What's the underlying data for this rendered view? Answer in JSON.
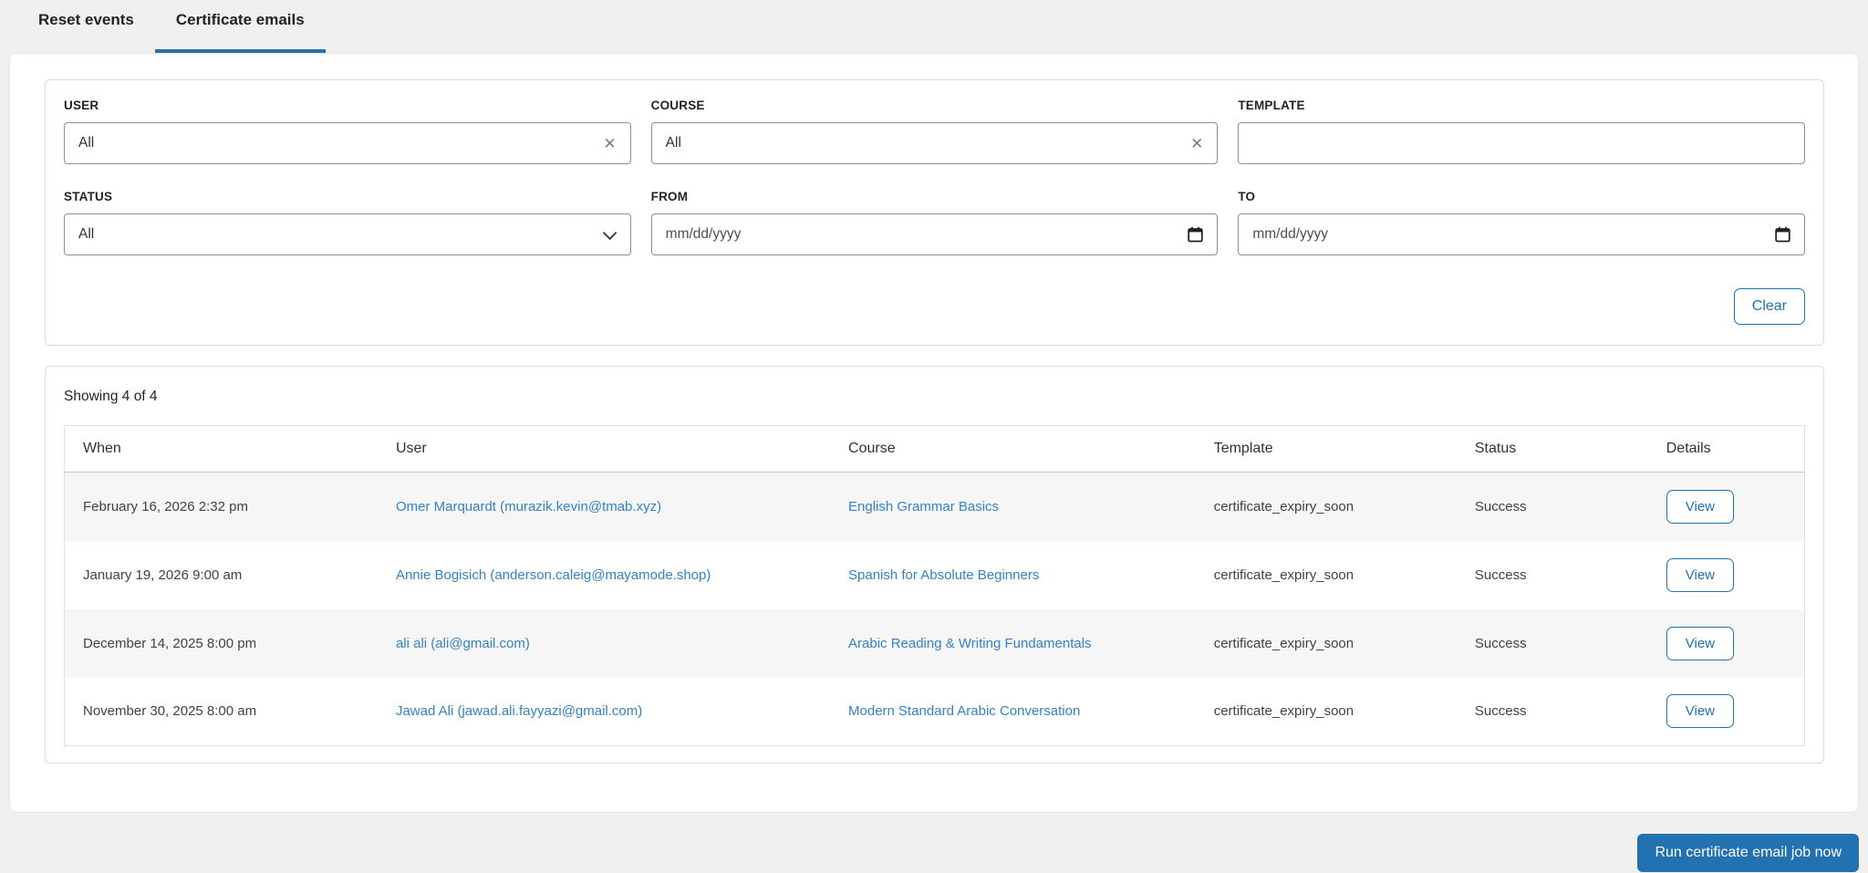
{
  "tabs": [
    {
      "label": "Reset events",
      "active": false
    },
    {
      "label": "Certificate emails",
      "active": true
    }
  ],
  "filters": {
    "user": {
      "label": "USER",
      "value": "All"
    },
    "course": {
      "label": "COURSE",
      "value": "All"
    },
    "template": {
      "label": "TEMPLATE",
      "value": ""
    },
    "status": {
      "label": "STATUS",
      "value": "All"
    },
    "from": {
      "label": "FROM",
      "placeholder": "mm/dd/yyyy"
    },
    "to": {
      "label": "TO",
      "placeholder": "mm/dd/yyyy"
    },
    "clear_label": "Clear"
  },
  "icons": {
    "clear_glyph": "✕"
  },
  "results": {
    "summary": "Showing 4 of 4",
    "columns": [
      "When",
      "User",
      "Course",
      "Template",
      "Status",
      "Details"
    ],
    "view_label": "View",
    "rows": [
      {
        "when": "February 16, 2026 2:32 pm",
        "user": "Omer Marquardt (murazik.kevin@tmab.xyz)",
        "course": "English Grammar Basics",
        "template": "certificate_expiry_soon",
        "status": "Success"
      },
      {
        "when": "January 19, 2026 9:00 am",
        "user": "Annie Bogisich (anderson.caleig@mayamode.shop)",
        "course": "Spanish for Absolute Beginners",
        "template": "certificate_expiry_soon",
        "status": "Success"
      },
      {
        "when": "December 14, 2025 8:00 pm",
        "user": "ali ali (ali@gmail.com)",
        "course": "Arabic Reading & Writing Fundamentals",
        "template": "certificate_expiry_soon",
        "status": "Success"
      },
      {
        "when": "November 30, 2025 8:00 am",
        "user": "Jawad Ali (jawad.ali.fayyazi@gmail.com)",
        "course": "Modern Standard Arabic Conversation",
        "template": "certificate_expiry_soon",
        "status": "Success"
      }
    ]
  },
  "actions": {
    "run_job_label": "Run certificate email job now"
  },
  "colors": {
    "accent_blue": "#2271b1",
    "link_blue": "#3582c4",
    "page_bg": "#f0f0f1",
    "row_stripe": "#f6f6f7"
  }
}
